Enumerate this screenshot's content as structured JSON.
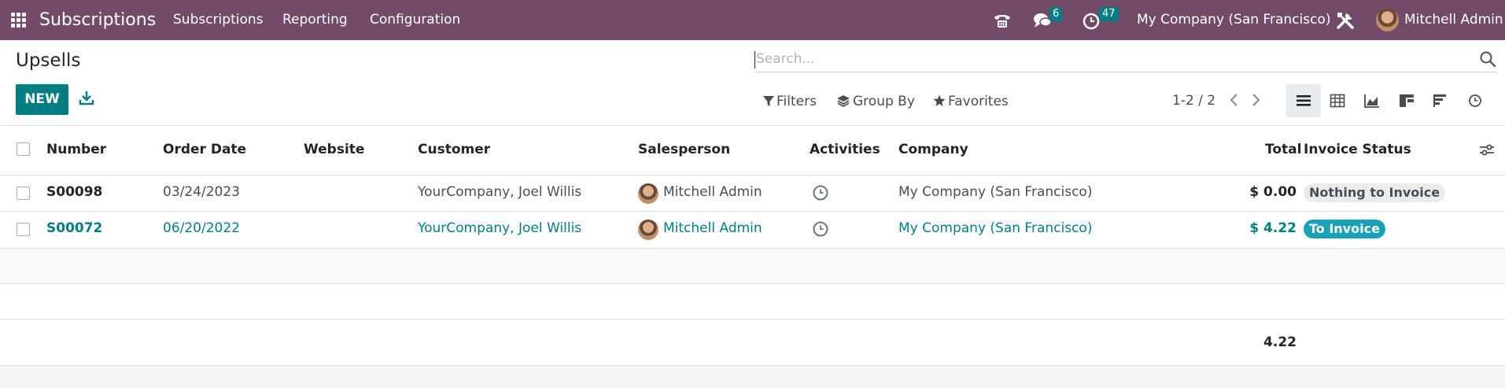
{
  "app": {
    "title": "Subscriptions",
    "menu": {
      "subscriptions": "Subscriptions",
      "reporting": "Reporting",
      "configuration": "Configuration"
    },
    "messages_count": "6",
    "activities_count": "47",
    "company": "My Company (San Francisco)",
    "user": "Mitchell Admin"
  },
  "page": {
    "title": "Upsells",
    "new_label": "NEW",
    "search_placeholder": "Search...",
    "filters_label": "Filters",
    "groupby_label": "Group By",
    "favorites_label": "Favorites",
    "pager": "1-2 / 2"
  },
  "icons": {
    "apps": "apps-grid-icon",
    "phone": "phone-icon",
    "chat": "chat-icon",
    "activity": "clock-icon",
    "tools": "tools-icon",
    "download": "download-icon",
    "search": "search-icon",
    "filter": "filter-icon",
    "layers": "layers-icon",
    "star": "star-icon"
  },
  "colors": {
    "navbar": "#714B67",
    "primary": "#017e84",
    "to_invoice_badge": "#17a2b8",
    "nothing_badge": "#e9ecef"
  },
  "table": {
    "columns": {
      "number": "Number",
      "order_date": "Order Date",
      "website": "Website",
      "customer": "Customer",
      "salesperson": "Salesperson",
      "activities": "Activities",
      "company": "Company",
      "total": "Total",
      "invoice_status": "Invoice Status"
    },
    "rows": [
      {
        "number": "S00098",
        "order_date": "03/24/2023",
        "website": "",
        "customer": "YourCompany, Joel Willis",
        "salesperson": "Mitchell Admin",
        "company": "My Company (San Francisco)",
        "total": "$ 0.00",
        "invoice_status": "Nothing to Invoice"
      },
      {
        "number": "S00072",
        "order_date": "06/20/2022",
        "website": "",
        "customer": "YourCompany, Joel Willis",
        "salesperson": "Mitchell Admin",
        "company": "My Company (San Francisco)",
        "total": "$ 4.22",
        "invoice_status": "To Invoice"
      }
    ],
    "sum_total": "4.22"
  }
}
